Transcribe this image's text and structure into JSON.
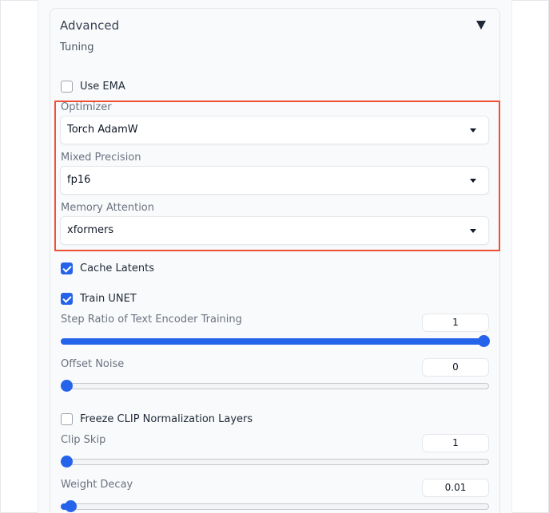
{
  "accordion": {
    "title": "Advanced",
    "subtitle": "Tuning",
    "caret_icon": "triangle-down-icon"
  },
  "use_ema": {
    "label": "Use EMA",
    "checked": false
  },
  "optimizer": {
    "label": "Optimizer",
    "value": "Torch AdamW"
  },
  "mixed_precision": {
    "label": "Mixed Precision",
    "value": "fp16"
  },
  "memory_attention": {
    "label": "Memory Attention",
    "value": "xformers"
  },
  "cache_latents": {
    "label": "Cache Latents",
    "checked": true
  },
  "train_unet": {
    "label": "Train UNET",
    "checked": true
  },
  "step_ratio": {
    "label": "Step Ratio of Text Encoder Training",
    "value": "1",
    "slider_fraction": 1.0
  },
  "offset_noise": {
    "label": "Offset Noise",
    "value": "0",
    "slider_fraction": 0.0
  },
  "freeze_clip": {
    "label": "Freeze CLIP Normalization Layers",
    "checked": false
  },
  "clip_skip": {
    "label": "Clip Skip",
    "value": "1",
    "slider_fraction": 0.0
  },
  "weight_decay": {
    "label": "Weight Decay",
    "value": "0.01",
    "slider_fraction": 0.01
  },
  "colors": {
    "accent": "#2563eb",
    "highlight": "#ef4f35"
  }
}
